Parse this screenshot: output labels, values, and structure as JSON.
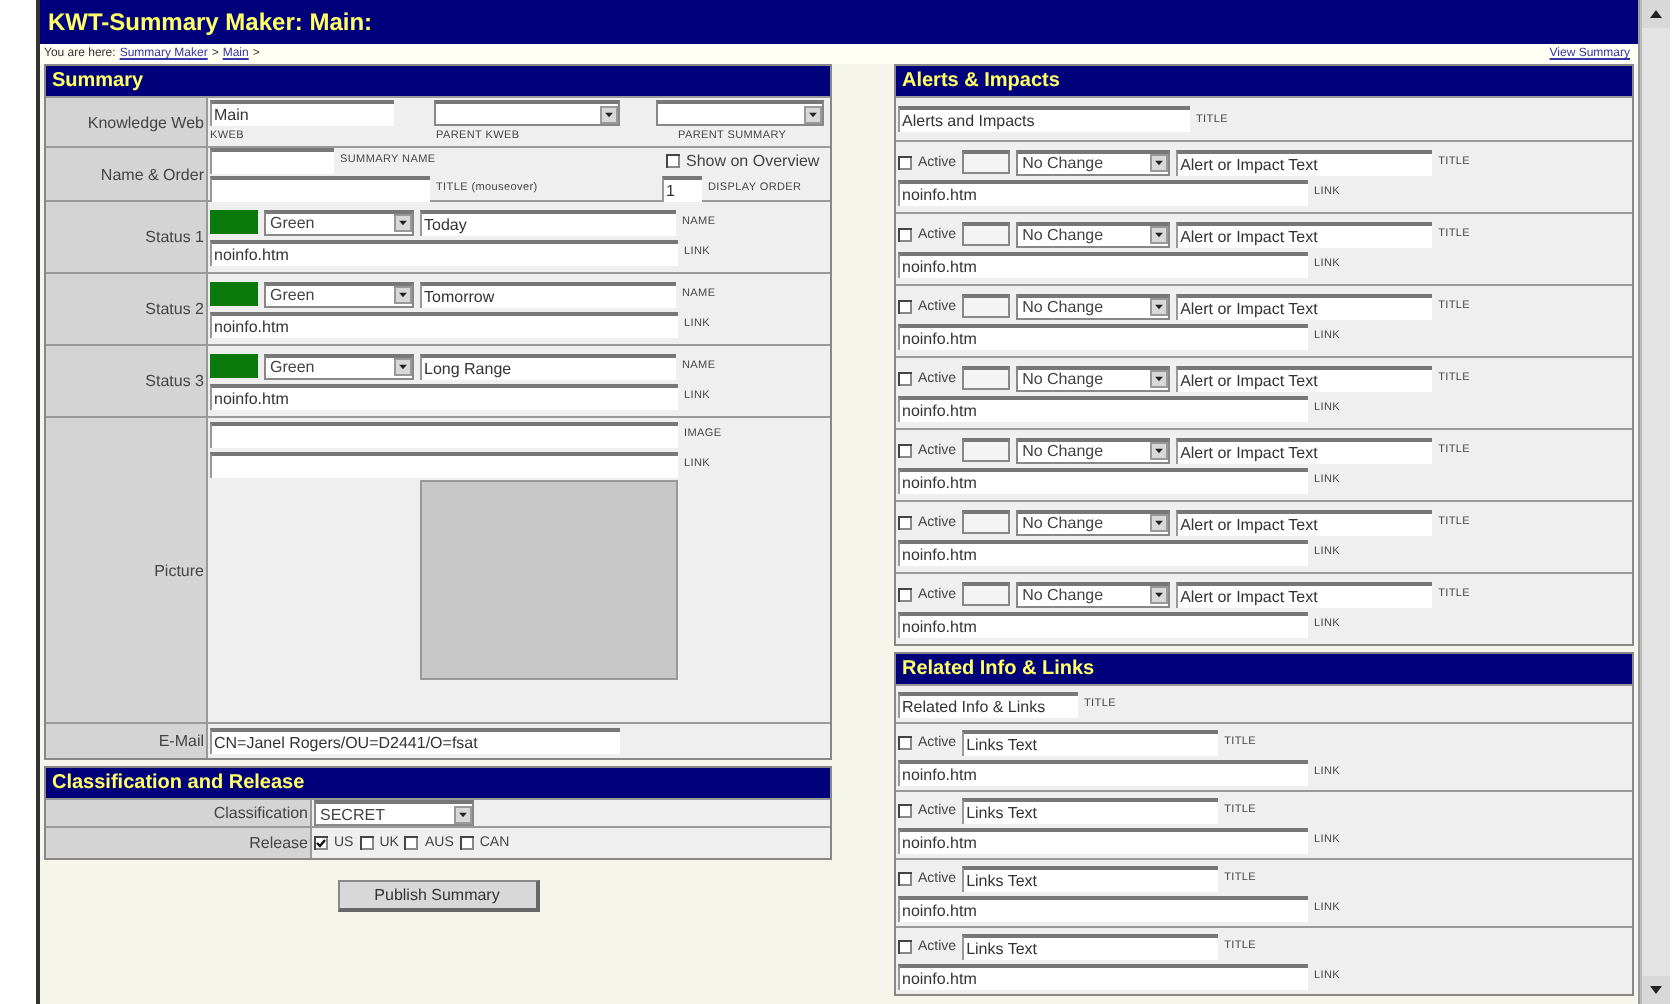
{
  "window": {
    "title": "KWT-Summary Maker: Main:"
  },
  "breadcrumb": [
    {
      "kind": "text",
      "text": "You are here:"
    },
    {
      "kind": "link",
      "text": "Summary Maker"
    },
    {
      "kind": "text",
      "text": ">"
    },
    {
      "kind": "link",
      "text": "Main"
    },
    {
      "kind": "text",
      "text": ">"
    }
  ],
  "view_summary_link": "View Summary",
  "summary": {
    "header": "Summary",
    "knowledge_web": {
      "label": "Knowledge Web",
      "kweb": {
        "value": "Main",
        "caption": "KWEB"
      },
      "parent_kweb": {
        "caption": "PARENT KWEB"
      },
      "parent_summary": {
        "caption": "PARENT SUMMARY"
      }
    },
    "name_order": {
      "label": "Name & Order",
      "summary_name_caption": "SUMMARY NAME",
      "title_caption": "TITLE (mouseover)",
      "show_on_overview": {
        "label": "Show on Overview",
        "checked": false
      },
      "display_order": {
        "value": "1",
        "caption": "DISPLAY ORDER"
      }
    },
    "statuses": [
      {
        "label": "Status 1",
        "color": "#0a7a0a",
        "option": "Green",
        "name": "Today",
        "name_caption": "NAME",
        "link": "noinfo.htm",
        "link_caption": "LINK"
      },
      {
        "label": "Status 2",
        "color": "#0a7a0a",
        "option": "Green",
        "name": "Tomorrow",
        "name_caption": "NAME",
        "link": "noinfo.htm",
        "link_caption": "LINK"
      },
      {
        "label": "Status 3",
        "color": "#0a7a0a",
        "option": "Green",
        "name": "Long Range",
        "name_caption": "NAME",
        "link": "noinfo.htm",
        "link_caption": "LINK"
      }
    ],
    "picture": {
      "label": "Picture",
      "image_caption": "IMAGE",
      "link_caption": "LINK"
    },
    "email": {
      "label": "E-Mail",
      "value": "CN=Janel Rogers/OU=D2441/O=fsat"
    }
  },
  "classification": {
    "header": "Classification and Release",
    "classification": {
      "label": "Classification",
      "value": "SECRET"
    },
    "release": {
      "label": "Release",
      "options": [
        {
          "label": "US",
          "checked": true
        },
        {
          "label": "UK",
          "checked": false
        },
        {
          "label": "AUS",
          "checked": false
        },
        {
          "label": "CAN",
          "checked": false
        }
      ]
    }
  },
  "publish_button": "Publish Summary",
  "alerts": {
    "header": "Alerts & Impacts",
    "title": {
      "value": "Alerts and Impacts",
      "caption": "TITLE"
    },
    "rows": [
      {
        "active": false,
        "active_label": "Active",
        "status": "No Change",
        "text": "Alert or Impact Text",
        "title_caption": "TITLE",
        "link": "noinfo.htm",
        "link_caption": "LINK"
      },
      {
        "active": false,
        "active_label": "Active",
        "status": "No Change",
        "text": "Alert or Impact Text",
        "title_caption": "TITLE",
        "link": "noinfo.htm",
        "link_caption": "LINK"
      },
      {
        "active": false,
        "active_label": "Active",
        "status": "No Change",
        "text": "Alert or Impact Text",
        "title_caption": "TITLE",
        "link": "noinfo.htm",
        "link_caption": "LINK"
      },
      {
        "active": false,
        "active_label": "Active",
        "status": "No Change",
        "text": "Alert or Impact Text",
        "title_caption": "TITLE",
        "link": "noinfo.htm",
        "link_caption": "LINK"
      },
      {
        "active": false,
        "active_label": "Active",
        "status": "No Change",
        "text": "Alert or Impact Text",
        "title_caption": "TITLE",
        "link": "noinfo.htm",
        "link_caption": "LINK"
      },
      {
        "active": false,
        "active_label": "Active",
        "status": "No Change",
        "text": "Alert or Impact Text",
        "title_caption": "TITLE",
        "link": "noinfo.htm",
        "link_caption": "LINK"
      },
      {
        "active": false,
        "active_label": "Active",
        "status": "No Change",
        "text": "Alert or Impact Text",
        "title_caption": "TITLE",
        "link": "noinfo.htm",
        "link_caption": "LINK"
      }
    ]
  },
  "related": {
    "header": "Related Info & Links",
    "title": {
      "value": "Related Info & Links",
      "caption": "TITLE"
    },
    "rows": [
      {
        "active": false,
        "active_label": "Active",
        "text": "Links Text",
        "title_caption": "TITLE",
        "link": "noinfo.htm",
        "link_caption": "LINK"
      },
      {
        "active": false,
        "active_label": "Active",
        "text": "Links Text",
        "title_caption": "TITLE",
        "link": "noinfo.htm",
        "link_caption": "LINK"
      },
      {
        "active": false,
        "active_label": "Active",
        "text": "Links Text",
        "title_caption": "TITLE",
        "link": "noinfo.htm",
        "link_caption": "LINK"
      },
      {
        "active": false,
        "active_label": "Active",
        "text": "Links Text",
        "title_caption": "TITLE",
        "link": "noinfo.htm",
        "link_caption": "LINK"
      }
    ]
  }
}
